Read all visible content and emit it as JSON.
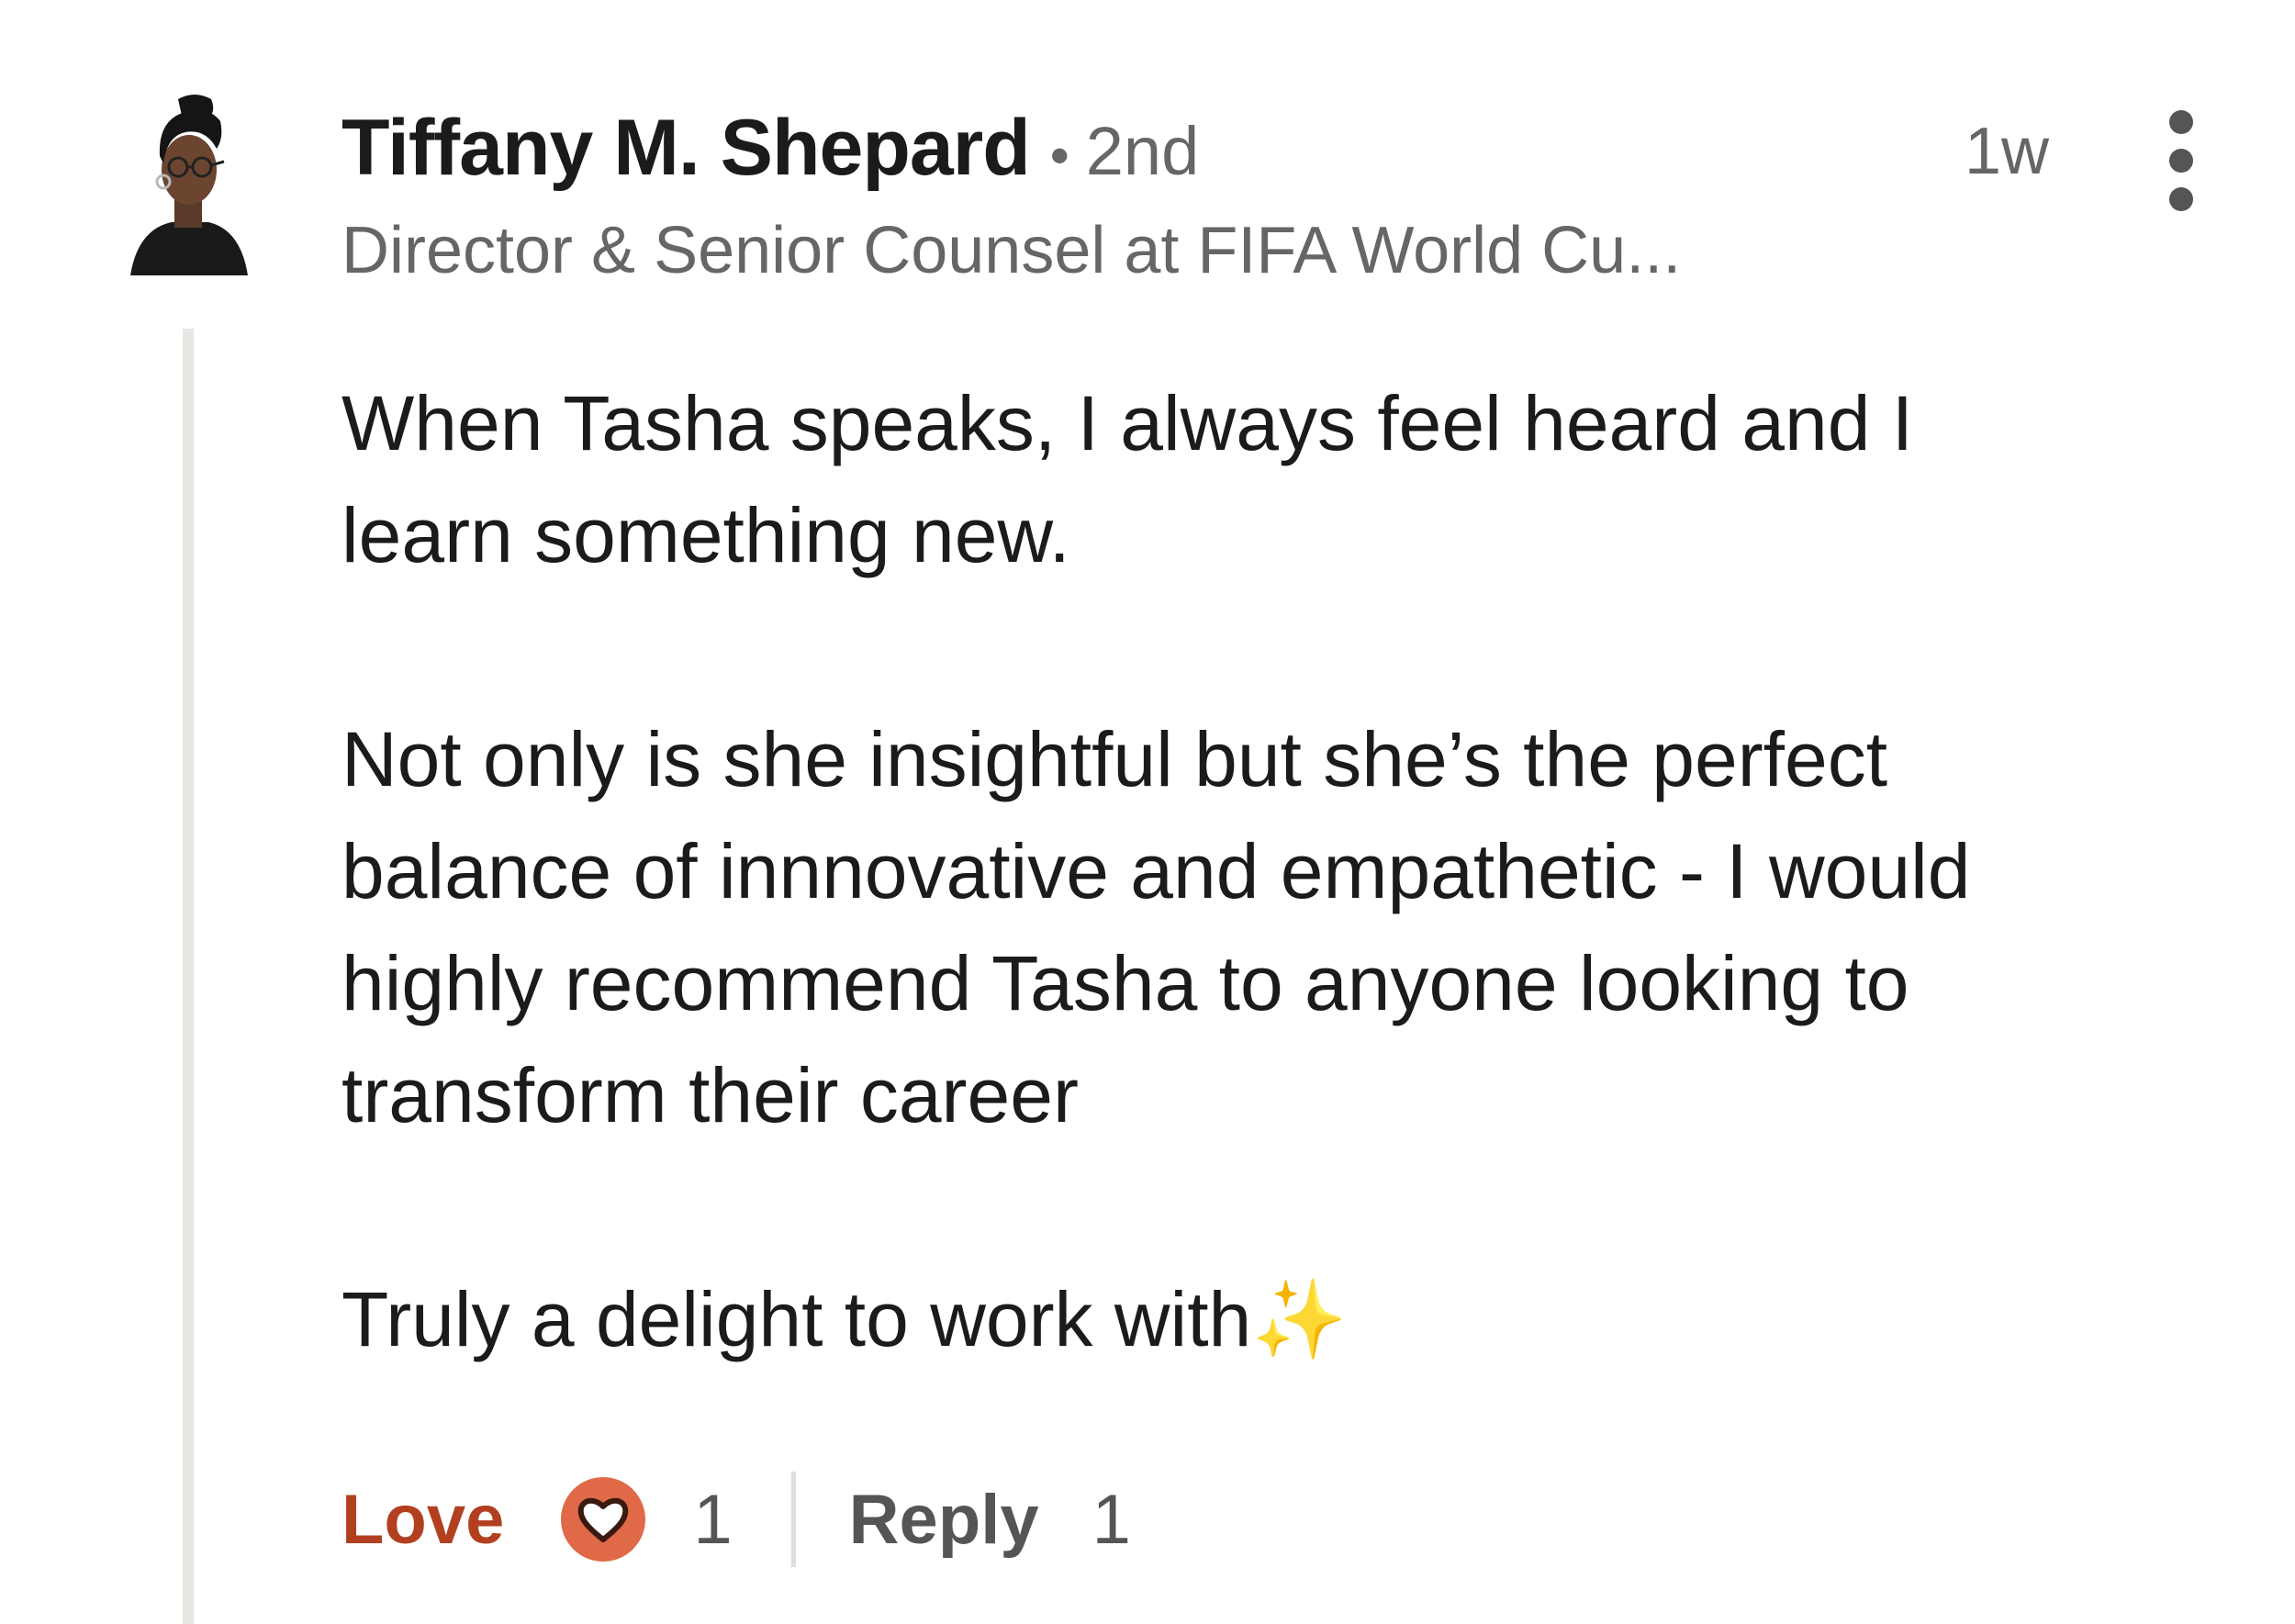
{
  "comment": {
    "author": {
      "name": "Tiffany M. Shepard",
      "separator": "•",
      "connection_degree": "2nd",
      "headline": "Director & Senior Counsel at FIFA World Cu..."
    },
    "timestamp": "1w",
    "body": [
      "When Tasha speaks, I always feel heard and I",
      "learn something new.",
      "Not only is she insightful but she’s the perfect",
      "balance of innnovative and empathetic - I would",
      "highly recommend Tasha to anyone looking to",
      "transform their career",
      "Truly a delight to work with✨"
    ],
    "actions": {
      "love_label": "Love",
      "love_count": "1",
      "reply_label": "Reply",
      "reply_count": "1"
    }
  },
  "icons": {
    "avatar": "profile-photo",
    "more": "three-dots-vertical-icon",
    "reaction": "heart-icon"
  },
  "colors": {
    "love_accent": "#b24020",
    "reaction_bg": "#e06a47",
    "primary_text": "#1b1b1b",
    "secondary_text": "#666666",
    "thread_line": "#e8e6e3"
  }
}
